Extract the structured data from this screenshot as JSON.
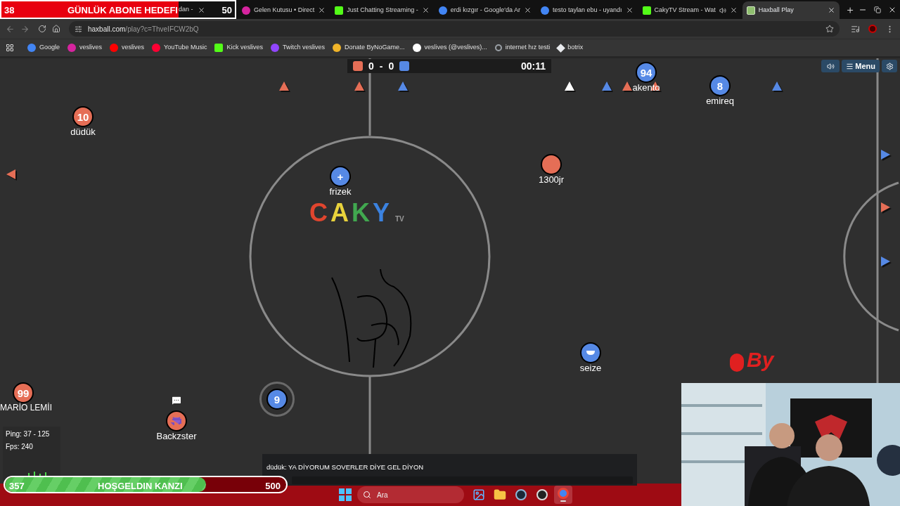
{
  "goal_overlay": {
    "current": "38",
    "title": "GÜNLÜK ABONE HEDEFI",
    "target": "50",
    "level": 0.76
  },
  "tabs": [
    {
      "title": "dan -",
      "selected": false,
      "audio": false
    },
    {
      "title": "Gelen Kutusu • Direct",
      "kind": "instagram",
      "selected": false,
      "audio": false
    },
    {
      "title": "Just Chatting Streaming -",
      "kind": "kick",
      "selected": false,
      "audio": false
    },
    {
      "title": "erdi kızgır - Google'da Ar",
      "kind": "google",
      "selected": false,
      "audio": false
    },
    {
      "title": "testo taylan ebu - uyandı",
      "kind": "google",
      "selected": false,
      "audio": false
    },
    {
      "title": "CakyTV Stream - Wat",
      "kind": "kick",
      "selected": false,
      "audio": true
    },
    {
      "title": "Haxball Play",
      "kind": "haxball",
      "selected": true,
      "audio": false
    }
  ],
  "address": {
    "host": "haxball.com",
    "path": "/play?c=ThveIFCW2bQ"
  },
  "bookmarks": [
    {
      "label": "Google",
      "kind": "google"
    },
    {
      "label": "veslives",
      "kind": "instagram"
    },
    {
      "label": "veslives",
      "kind": "youtube"
    },
    {
      "label": "YouTube Music",
      "kind": "music"
    },
    {
      "label": "Kick veslives",
      "kind": "kick"
    },
    {
      "label": "Twitch veslives",
      "kind": "twitch"
    },
    {
      "label": "Donate ByNoGame...",
      "kind": "donate"
    },
    {
      "label": "veslives (@veslives)...",
      "kind": "tiktok"
    },
    {
      "label": "internet hız testi",
      "kind": "globe"
    },
    {
      "label": "botrix",
      "kind": "botrix"
    }
  ],
  "scoreboard": {
    "red_score": "0",
    "separator": "-",
    "blue_score": "0",
    "time": "00:11"
  },
  "game_menu": {
    "menu_label": "Menu"
  },
  "logo": {
    "letters": [
      {
        "text": "C",
        "color": "#e0452e"
      },
      {
        "text": "A",
        "color": "#e8d23c"
      },
      {
        "text": "K",
        "color": "#41a84f"
      },
      {
        "text": "Y",
        "color": "#3b82e0"
      }
    ],
    "suffix": "TV"
  },
  "markers": [
    {
      "color": "#e56e56",
      "kind": "up"
    },
    {
      "color": "#e56e56",
      "kind": "up"
    },
    {
      "color": "#5689e5",
      "kind": "up"
    },
    {
      "color": "#ffffff",
      "kind": "up"
    },
    {
      "color": "#5689e5",
      "kind": "up"
    },
    {
      "color": "#e56e56",
      "kind": "up"
    },
    {
      "color": "#e56e56",
      "kind": "up"
    },
    {
      "color": "#5689e5",
      "kind": "up"
    },
    {
      "color": "#e56e56",
      "kind": "left"
    },
    {
      "color": "#5689e5",
      "kind": "right"
    },
    {
      "color": "#e56e56",
      "kind": "right"
    },
    {
      "color": "#5689e5",
      "kind": "right"
    }
  ],
  "players": [
    {
      "name": "düdük",
      "avatar": "10",
      "kind": "text",
      "color": "#e56e56",
      "selected": false
    },
    {
      "name": "akento",
      "avatar": "94",
      "kind": "text",
      "color": "#5689e5",
      "selected": false
    },
    {
      "name": "emireq",
      "avatar": "8",
      "kind": "text",
      "color": "#5689e5",
      "selected": false
    },
    {
      "name": "1300jr",
      "kind": "blank",
      "color": "#e56e56",
      "selected": false
    },
    {
      "name": "frizek",
      "avatar": "+",
      "kind": "text",
      "color": "#5689e5",
      "selected": false
    },
    {
      "name": "seize",
      "kind": "smile",
      "color": "#5689e5",
      "selected": false
    },
    {
      "name": "MARİO LEMİI",
      "avatar": "99",
      "kind": "text",
      "color": "#e56e56",
      "selected": false
    },
    {
      "avatar": "9",
      "kind": "text",
      "color": "#5689e5",
      "selected": true
    },
    {
      "name": "Backzster",
      "kind": "alien",
      "color": "#e56e56",
      "selected": false,
      "chatting": true
    }
  ],
  "brand_mark": "By",
  "stats": {
    "ping": "Ping: 37 - 125",
    "fps": "Fps: 240"
  },
  "chat": {
    "messages": [
      "düdük: YA DİYORUM SOVERLER DİYE GEL DİYON"
    ]
  },
  "welcome_bar": {
    "current": "357",
    "title": "HOŞGELDIN KANZI",
    "target": "500",
    "level": 0.714
  },
  "taskbar": {
    "search_placeholder": "Ara",
    "apps": [
      {
        "kind": "photos",
        "selected": false
      },
      {
        "kind": "folder",
        "selected": false
      },
      {
        "kind": "steam",
        "selected": false
      },
      {
        "kind": "obs",
        "selected": false
      },
      {
        "kind": "chrome",
        "selected": true
      }
    ]
  }
}
